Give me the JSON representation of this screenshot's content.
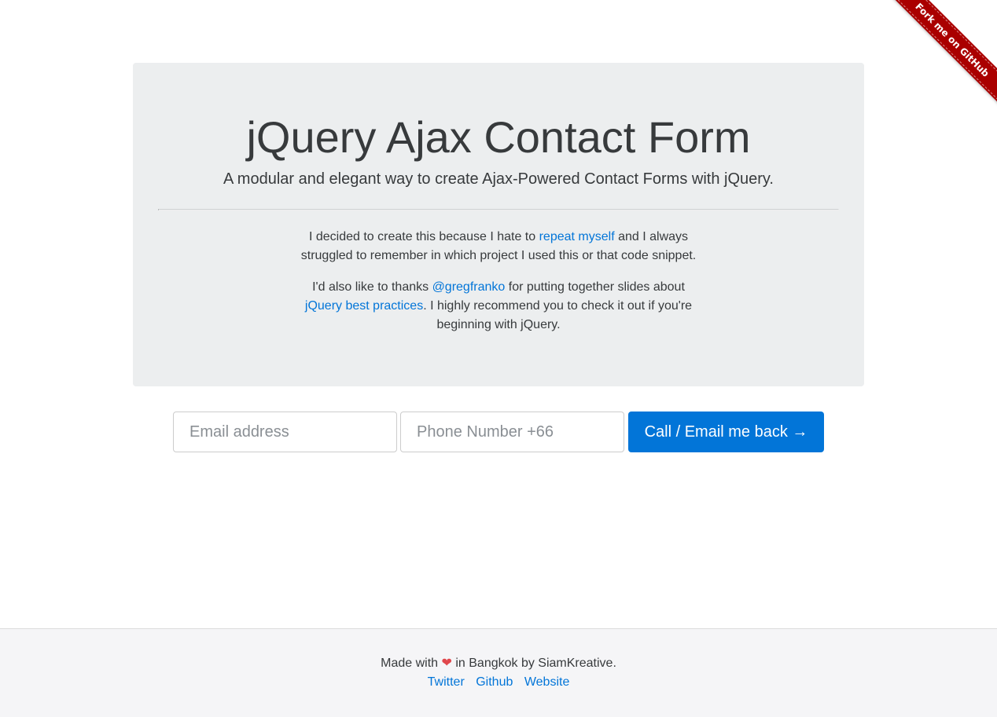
{
  "ribbon": {
    "label": "Fork me on GitHub",
    "color": "#aa0000"
  },
  "jumbotron": {
    "title": "jQuery Ajax Contact Form",
    "lead": "A modular and elegant way to create Ajax-Powered Contact Forms with jQuery.",
    "para1": {
      "before": "I decided to create this because I hate to ",
      "link": "repeat myself",
      "after": " and I always struggled to remember in which project I used this or that code snippet."
    },
    "para2": {
      "before": "I'd also like to thanks ",
      "link1": "@gregfranko",
      "middle": " for putting together slides about ",
      "link2": "jQuery best practices",
      "after": ". I highly recommend you to check it out if you're beginning with jQuery."
    }
  },
  "form": {
    "email_placeholder": "Email address",
    "phone_placeholder": "Phone Number +66",
    "submit_label": "Call / Email me back →"
  },
  "footer": {
    "made_with": "Made with",
    "heart_icon": "heart-icon",
    "location": "in Bangkok by SiamKreative.",
    "links": [
      "Twitter",
      "Github",
      "Website"
    ]
  },
  "colors": {
    "accent": "#0275d8",
    "jumbotron_bg": "#eceeef",
    "footer_bg": "#f5f5f7",
    "heart": "#e0474c"
  }
}
